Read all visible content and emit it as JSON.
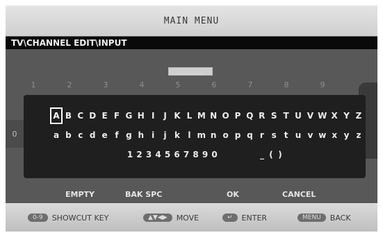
{
  "screen": {
    "title": "MAIN MENU",
    "breadcrumb": "TV\\CHANNEL EDIT\\INPUT",
    "entry_field": "_______",
    "number_row": [
      "1",
      "2",
      "3",
      "4",
      "5",
      "6",
      "7",
      "8",
      "9"
    ],
    "left_tab_label": "0"
  },
  "keyboard": {
    "uppercase": [
      "A",
      "B",
      "C",
      "D",
      "E",
      "F",
      "G",
      "H",
      "I",
      "J",
      "K",
      "L",
      "M",
      "N",
      "O",
      "P",
      "Q",
      "R",
      "S",
      "T",
      "U",
      "V",
      "W",
      "X",
      "Y",
      "Z"
    ],
    "lowercase": [
      "a",
      "b",
      "c",
      "d",
      "e",
      "f",
      "g",
      "h",
      "i",
      "j",
      "k",
      "l",
      "m",
      "n",
      "o",
      "p",
      "q",
      "r",
      "s",
      "t",
      "u",
      "v",
      "w",
      "x",
      "y",
      "z"
    ],
    "digits": [
      "1",
      "2",
      "3",
      "4",
      "5",
      "6",
      "7",
      "8",
      "9",
      "0"
    ],
    "symbols": [
      "_",
      "(",
      ")"
    ],
    "selected_key": "A"
  },
  "actions": {
    "empty": "EMPTY",
    "backspace": "BAK SPC",
    "ok": "OK",
    "cancel": "CANCEL"
  },
  "legend": {
    "shortcut_icon": "0-9",
    "shortcut_label": "SHOWCUT KEY",
    "move_icon": "▲▼◀▶",
    "move_label": "MOVE",
    "enter_icon": "↵",
    "enter_label": "ENTER",
    "menu_icon": "MENU",
    "back_label": "BACK"
  }
}
